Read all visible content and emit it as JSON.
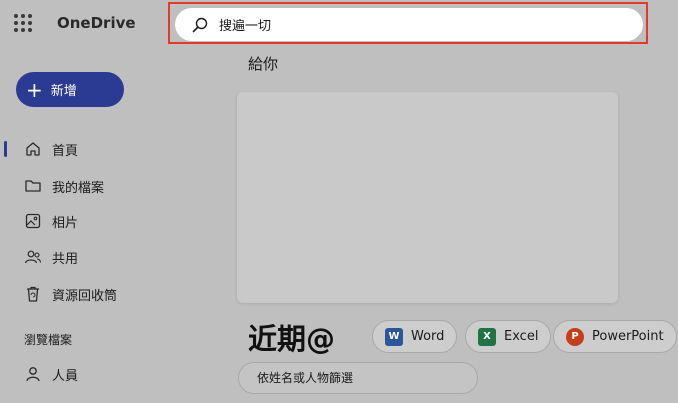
{
  "app": {
    "title": "OneDrive"
  },
  "search": {
    "text": "搜遍一切"
  },
  "sidebar": {
    "new_label": "新增",
    "items": [
      {
        "label": "首頁",
        "icon": "home-icon"
      },
      {
        "label": "我的檔案",
        "icon": "folder-icon"
      },
      {
        "label": "相片",
        "icon": "photo-icon"
      },
      {
        "label": "共用",
        "icon": "people-icon"
      },
      {
        "label": "資源回收筒",
        "icon": "recycle-bin-icon"
      }
    ],
    "section_label": "瀏覽檔案",
    "people_label": "人員"
  },
  "main": {
    "for_you": "給你",
    "recent_title": "近期@",
    "filters": [
      {
        "label": "Word",
        "color": "#2b579a",
        "letter": "W"
      },
      {
        "label": "Excel",
        "color": "#217346",
        "letter": "X"
      },
      {
        "label": "PowerPoint",
        "color": "#c43e1c",
        "letter": "P"
      }
    ],
    "filter_placeholder": "依姓名或人物篩選"
  },
  "colors": {
    "accent": "#2b3a93",
    "highlight": "#e03a2f"
  }
}
